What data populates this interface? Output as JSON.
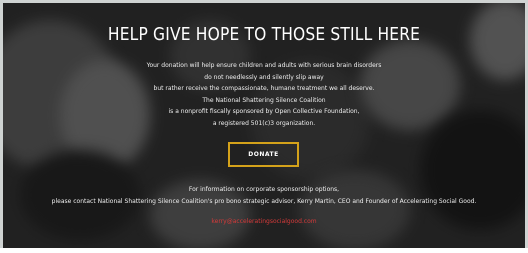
{
  "hero": {
    "title": "HELP GIVE HOPE TO THOSE STILL HERE",
    "lines": [
      "Your donation will help ensure children and adults with serious brain disorders",
      "do not needlessly and silently slip away",
      "but rather receive the compassionate, humane treatment we all deserve.",
      "The National Shattering Silence Coalition",
      "is a nonprofit fiscally sponsored by Open Collective Foundation,",
      "a registered 501(c)3 organization."
    ],
    "donate_label": "DONATE",
    "footer": {
      "line1": "For information on corporate sponsorship options,",
      "line2": "please contact National Shattering Silence Coalition's pro bono strategic advisor, Kerry Martin, CEO and Founder of Accelerating Social Good.",
      "email": "kerry@acceleratingsocialgood.com"
    }
  },
  "colors": {
    "donate_border": "#d4a21a",
    "email": "#d63a3a",
    "text": "#ffffff"
  }
}
